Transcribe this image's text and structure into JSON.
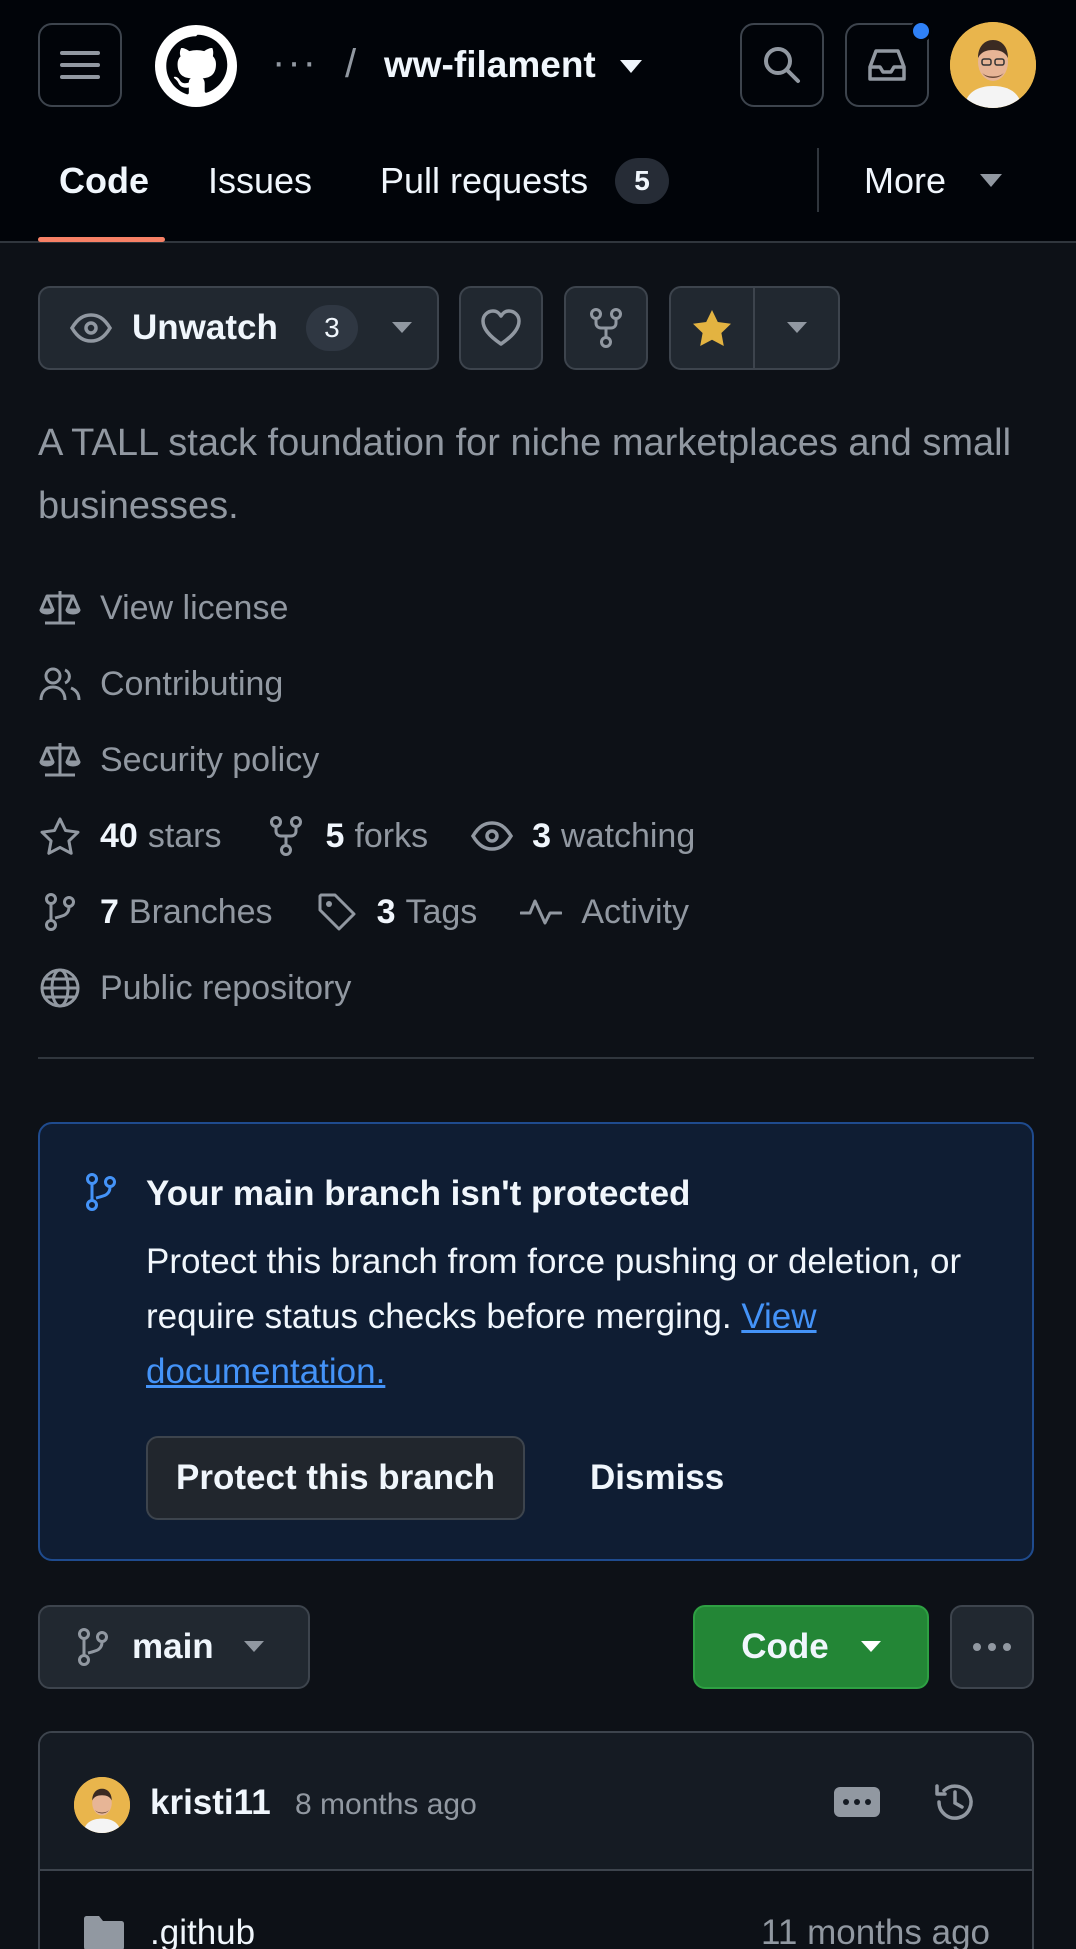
{
  "header": {
    "breadcrumb_dots": "···",
    "breadcrumb_slash": "/",
    "repo_name": "ww-filament"
  },
  "tabs": [
    {
      "label": "Code",
      "active": true
    },
    {
      "label": "Issues"
    },
    {
      "label": "Pull requests",
      "count": "5"
    },
    {
      "label": "More"
    }
  ],
  "actions": {
    "unwatch_label": "Unwatch",
    "watch_count": "3"
  },
  "description": "A TALL stack foundation for niche marketplaces and small businesses.",
  "meta": {
    "license": "View license",
    "contributing": "Contributing",
    "security": "Security policy",
    "stars_count": "40",
    "stars_label": "stars",
    "forks_count": "5",
    "forks_label": "forks",
    "watching_count": "3",
    "watching_label": "watching",
    "branches_count": "7",
    "branches_label": "Branches",
    "tags_count": "3",
    "tags_label": "Tags",
    "activity": "Activity",
    "visibility": "Public repository"
  },
  "banner": {
    "title": "Your main branch isn't protected",
    "text": "Protect this branch from force pushing or deletion, or require status checks before merging.",
    "link": "View documentation.",
    "protect_button": "Protect this branch",
    "dismiss_button": "Dismiss"
  },
  "branch": {
    "name": "main",
    "code_button": "Code"
  },
  "commit": {
    "user": "kristi11",
    "time": "8 months ago"
  },
  "files": [
    {
      "name": ".github",
      "time": "11 months ago"
    }
  ],
  "colors": {
    "accent_green": "#238636",
    "link_blue": "#4493f8",
    "tab_underline": "#f78166",
    "star_yellow": "#e3b341"
  }
}
